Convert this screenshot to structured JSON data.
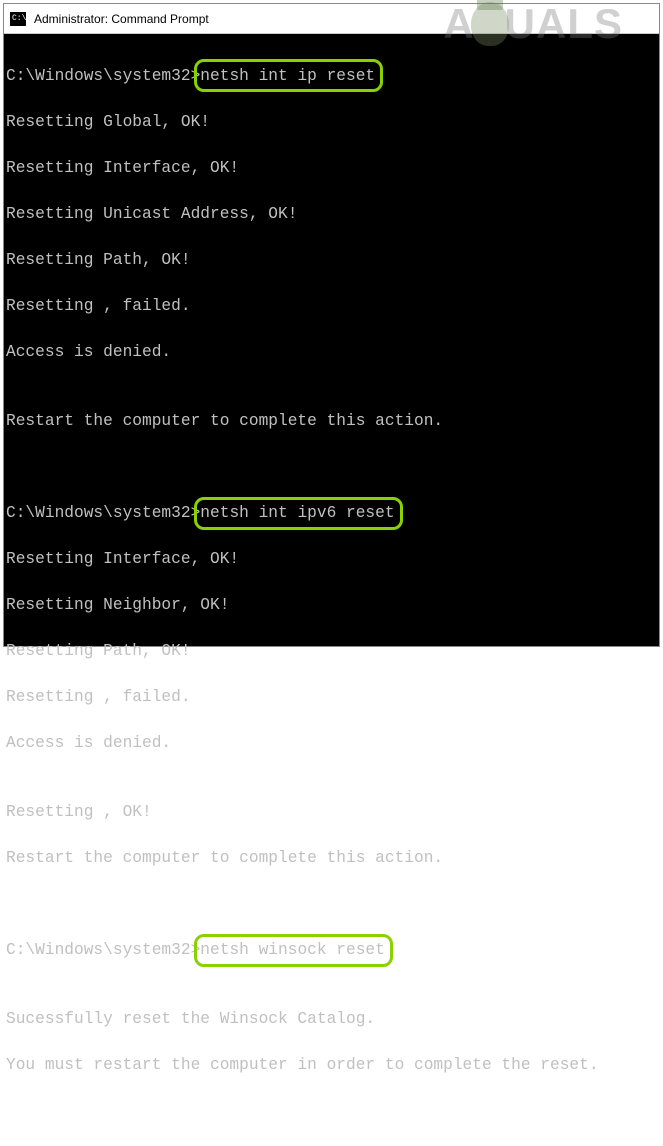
{
  "window": {
    "title": "Administrator: Command Prompt"
  },
  "watermark": {
    "left": "A",
    "right": "UALS"
  },
  "session": {
    "prompt": "C:\\Windows\\system32>",
    "blocks": [
      {
        "cmd": "netsh int ip reset",
        "out": [
          "Resetting Global, OK!",
          "Resetting Interface, OK!",
          "Resetting Unicast Address, OK!",
          "Resetting Path, OK!",
          "Resetting , failed.",
          "Access is denied.",
          "",
          "Restart the computer to complete this action.",
          "",
          ""
        ]
      },
      {
        "cmd": "netsh int ipv6 reset",
        "out": [
          "Resetting Interface, OK!",
          "Resetting Neighbor, OK!",
          "Resetting Path, OK!",
          "Resetting , failed.",
          "Access is denied.",
          "",
          "Resetting , OK!",
          "Restart the computer to complete this action.",
          "",
          ""
        ]
      },
      {
        "cmd": "netsh winsock reset",
        "out": [
          "",
          "Sucessfully reset the Winsock Catalog.",
          "You must restart the computer in order to complete the reset.",
          ""
        ]
      }
    ]
  }
}
